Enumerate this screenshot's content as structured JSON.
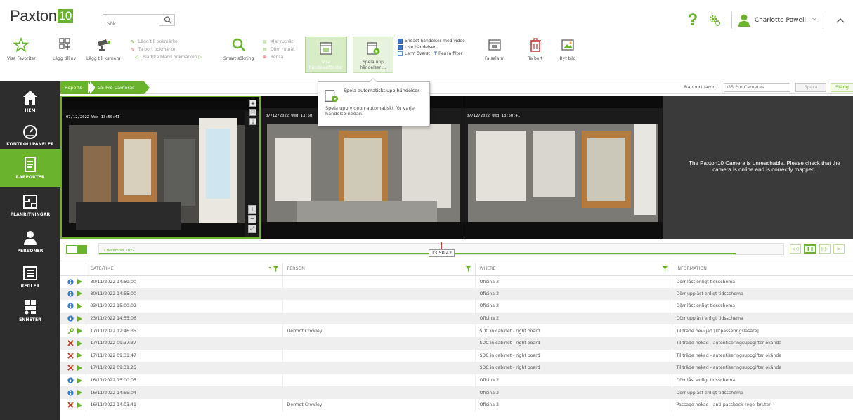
{
  "app": {
    "logo_text": "Paxton",
    "logo_number": "10"
  },
  "search": {
    "value": "Sök"
  },
  "user": {
    "name": "Charlotte Powell"
  },
  "ribbon": {
    "buttons": {
      "show_favorites": "Visa Favoriter",
      "add_new": "Lägg till ny",
      "add_camera": "Lägg till kamera",
      "smart_search": "Smart sökning",
      "show_event_window": "Visa händelsefönster",
      "play_events": "Spela upp händelser ...",
      "false_alarm": "Falsalarm",
      "delete": "Ta bort",
      "change_image": "Byt bild"
    },
    "bookmarks": [
      "Lägg till bokmärke",
      "Ta bort bokmärke",
      "Bläddra bland bokmärken"
    ],
    "filters": [
      "Klar rutnät",
      "Döm rutnät",
      "Rensa"
    ],
    "checkboxes": [
      "Endast händelser med video",
      "Live händelser",
      "Larm överst"
    ],
    "clear_filter": "Rensa filter"
  },
  "sidebar": {
    "items": [
      {
        "label": "HEM"
      },
      {
        "label": "KONTROLLPANELER"
      },
      {
        "label": "RAPPORTER"
      },
      {
        "label": "PLANRITNINGAR"
      },
      {
        "label": "PERSONER"
      },
      {
        "label": "REGLER"
      },
      {
        "label": "ENHETER"
      }
    ]
  },
  "breadcrumb": [
    "Reports",
    "G5 Pro Cameras"
  ],
  "report": {
    "name_label": "Rapportnamn",
    "name_value": "G5 Pro Cameras",
    "save_label": "Spara",
    "close_label": "Stäng"
  },
  "tiles": {
    "timestamp1": "07/12/2022 Wed 13:50:41",
    "timestamp2": "07/12/2022 Wed 13:50",
    "timestamp3": "07/12/2022 Wed 13:50:41",
    "unreachable": "The Paxton10 Camera is unreachable. Please check that the camera is online and is correctly mapped."
  },
  "tooltip": {
    "title": "Spela automatiskt upp händelser",
    "body": "Spela upp videon automatiskt för varje händelse nedan."
  },
  "timeline": {
    "date": "7 december 2022",
    "time": "13:50:42",
    "progress": 0.93,
    "marker_position": 0.5
  },
  "table": {
    "columns": [
      "DATE/TIME",
      "PERSON",
      "WHERE",
      "INFORMATION"
    ],
    "rows": [
      {
        "type": "info",
        "datetime": "30/11/2022 14:59:00",
        "person": "",
        "where": "Oficina 2",
        "info": "Dörr låst enligt tidsschema"
      },
      {
        "type": "info",
        "datetime": "30/11/2022 14:55:00",
        "person": "",
        "where": "Oficina 2",
        "info": "Dörr upplåst enligt tidsschema"
      },
      {
        "type": "info",
        "datetime": "23/11/2022 15:00:02",
        "person": "",
        "where": "Oficina 2",
        "info": "Dörr låst enligt tidsschema"
      },
      {
        "type": "info",
        "datetime": "23/11/2022 14:55:06",
        "person": "",
        "where": "Oficina 2",
        "info": "Dörr upplåst enligt tidsschema"
      },
      {
        "type": "granted",
        "datetime": "17/11/2022 12:46:35",
        "person": "Dermot Crowley",
        "where": "SDC in cabinet - right board",
        "info": "Tillträde beviljad [Utpasseringsläsare]"
      },
      {
        "type": "denied",
        "datetime": "17/11/2022 09:37:37",
        "person": "",
        "where": "SDC in cabinet - right board",
        "info": "Tillträde nekad - autentiseringsuppgifter okända"
      },
      {
        "type": "denied",
        "datetime": "17/11/2022 09:31:47",
        "person": "",
        "where": "SDC in cabinet - right board",
        "info": "Tillträde nekad - autentiseringsuppgifter okända"
      },
      {
        "type": "denied",
        "datetime": "17/11/2022 09:31:25",
        "person": "",
        "where": "SDC in cabinet - right board",
        "info": "Tillträde nekad - autentiseringsuppgifter okända"
      },
      {
        "type": "info",
        "datetime": "16/11/2022 15:00:05",
        "person": "",
        "where": "Oficina 2",
        "info": "Dörr låst enligt tidsschema"
      },
      {
        "type": "info",
        "datetime": "16/11/2022 14:55:04",
        "person": "",
        "where": "Oficina 2",
        "info": "Dörr upplåst enligt tidsschema"
      },
      {
        "type": "denied",
        "datetime": "16/11/2022 14:03:41",
        "person": "Dermot Crowley",
        "where": "Oficina 2",
        "info": "Passage nekad - anti-passback-regel bruten"
      }
    ]
  },
  "colors": {
    "accent": "#6ab42d",
    "sidebar": "#2d2d2d",
    "info": "#2f7dd1",
    "denied": "#c0392b"
  }
}
